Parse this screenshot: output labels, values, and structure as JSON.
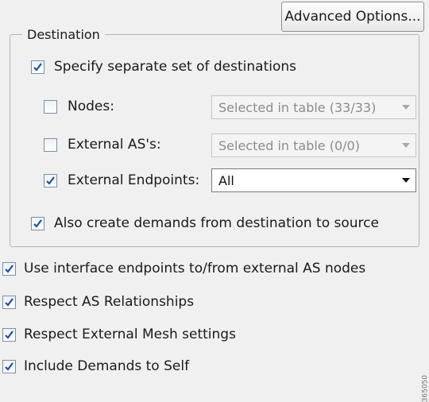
{
  "advanced_button": {
    "label": "Advanced Options..."
  },
  "destination": {
    "legend": "Destination",
    "specify_separate": {
      "label": "Specify separate set of destinations",
      "checked": true
    },
    "nodes": {
      "label": "Nodes:",
      "checked": false,
      "selection": "Selected in table (33/33)",
      "enabled": false
    },
    "external_as": {
      "label": "External AS's:",
      "checked": false,
      "selection": "Selected in table (0/0)",
      "enabled": false
    },
    "external_endpoints": {
      "label": "External Endpoints:",
      "checked": true,
      "selection": "All",
      "enabled": true
    },
    "also_create": {
      "label": "Also create demands from destination to source",
      "checked": true
    }
  },
  "options": {
    "use_interface_endpoints": {
      "label": "Use interface endpoints to/from external AS nodes",
      "checked": true
    },
    "respect_as_relationships": {
      "label": "Respect AS Relationships",
      "checked": true
    },
    "respect_external_mesh": {
      "label": "Respect External Mesh settings",
      "checked": true
    },
    "include_demands_to_self": {
      "label": "Include Demands to Self",
      "checked": true
    }
  },
  "figure_id": "365050",
  "colors": {
    "check_mark": "#1f4e9a",
    "background": "#f0f0f0"
  },
  "icons": {
    "check": "check-icon",
    "dropdown": "chevron-down-icon"
  }
}
